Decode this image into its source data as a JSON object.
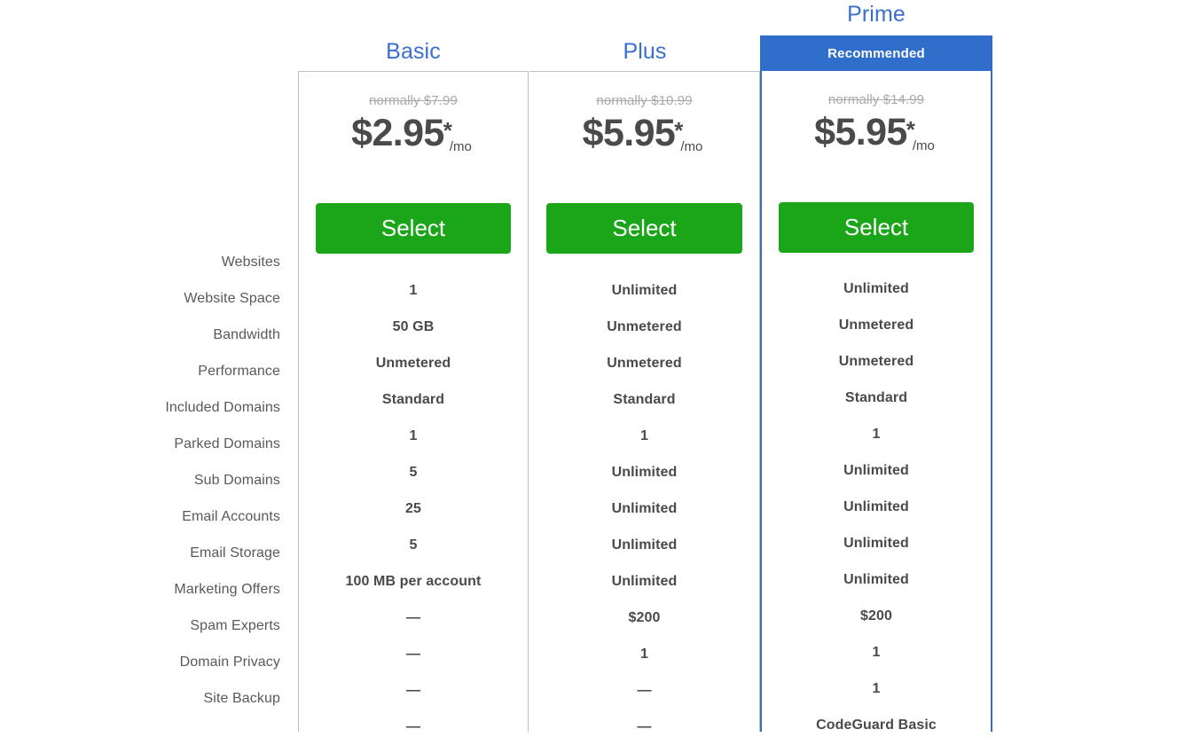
{
  "features": [
    "Websites",
    "Website Space",
    "Bandwidth",
    "Performance",
    "Included Domains",
    "Parked Domains",
    "Sub Domains",
    "Email Accounts",
    "Email Storage",
    "Marketing Offers",
    "Spam Experts",
    "Domain Privacy",
    "Site Backup"
  ],
  "colors": {
    "title_blue": "#3a6fd0",
    "banner_blue": "#2f6ecb",
    "select_green": "#1ba519",
    "value_gray": "#4a4a4a",
    "label_gray": "#595959",
    "strikethrough_gray": "#a9a9a9",
    "card_border": "#bdbdbd"
  },
  "plans": {
    "basic": {
      "title": "Basic",
      "normally": "normally $7.99",
      "price": "$2.95",
      "star": "*",
      "per": "/mo",
      "select_label": "Select",
      "values": [
        "1",
        "50 GB",
        "Unmetered",
        "Standard",
        "1",
        "5",
        "25",
        "5",
        "100 MB per account",
        "—",
        "—",
        "—",
        "—"
      ]
    },
    "plus": {
      "title": "Plus",
      "normally": "normally $10.99",
      "price": "$5.95",
      "star": "*",
      "per": "/mo",
      "select_label": "Select",
      "values": [
        "Unlimited",
        "Unmetered",
        "Unmetered",
        "Standard",
        "1",
        "Unlimited",
        "Unlimited",
        "Unlimited",
        "Unlimited",
        "$200",
        "1",
        "—",
        "—"
      ]
    },
    "prime": {
      "title": "Prime",
      "banner": "Recommended",
      "normally": "normally $14.99",
      "price": "$5.95",
      "star": "*",
      "per": "/mo",
      "select_label": "Select",
      "values": [
        "Unlimited",
        "Unmetered",
        "Unmetered",
        "Standard",
        "1",
        "Unlimited",
        "Unlimited",
        "Unlimited",
        "Unlimited",
        "$200",
        "1",
        "1",
        "CodeGuard Basic"
      ]
    }
  }
}
